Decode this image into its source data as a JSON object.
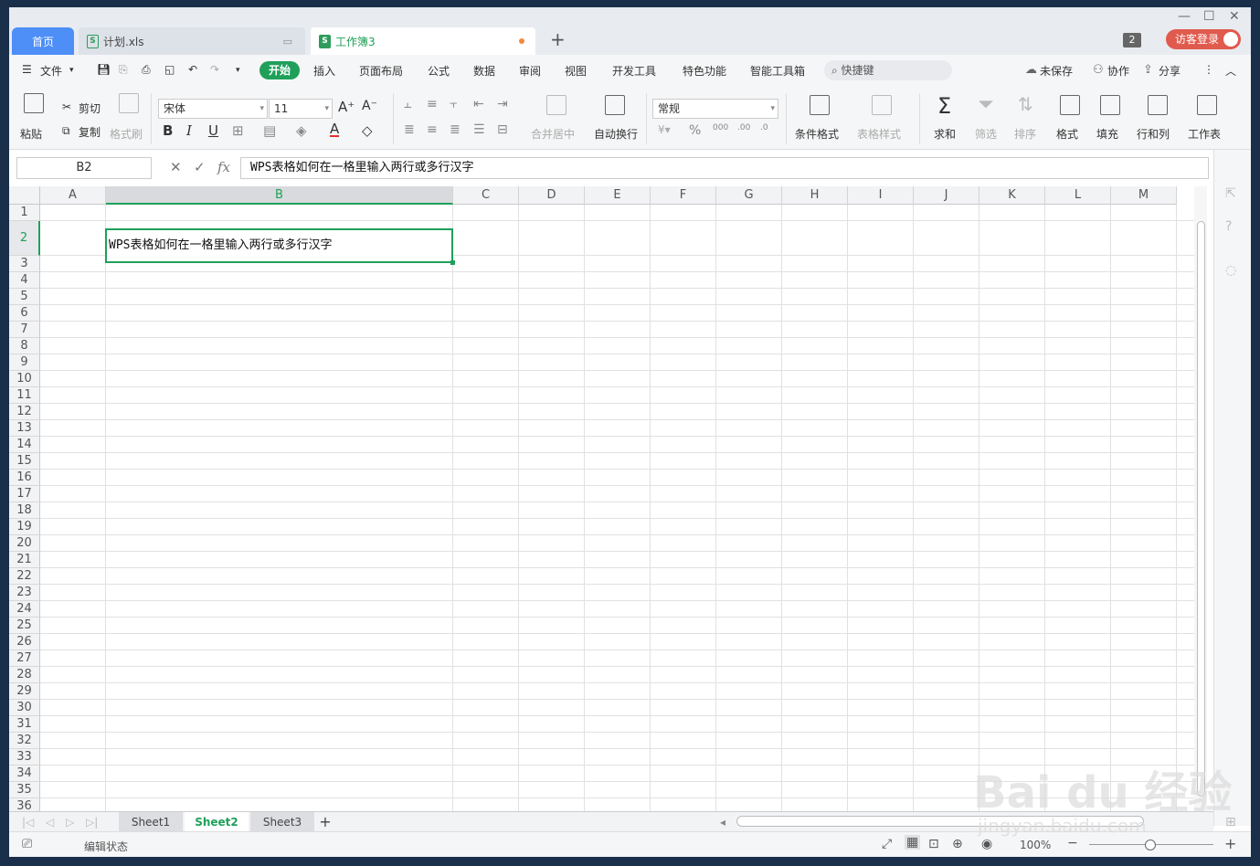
{
  "tabs": {
    "home": "首页",
    "file1": "计划.xls",
    "active": "工作簿3",
    "new": "+"
  },
  "titlebar": {
    "badge": "2",
    "login": "访客登录"
  },
  "menubar": {
    "file": "文件",
    "items": [
      "开始",
      "插入",
      "页面布局",
      "公式",
      "数据",
      "审阅",
      "视图",
      "开发工具",
      "特色功能",
      "智能工具箱"
    ],
    "search": "快捷键",
    "unsaved": "未保存",
    "collab": "协作",
    "share": "分享"
  },
  "ribbon": {
    "paste": "粘贴",
    "cut": "剪切",
    "copy": "复制",
    "format_painter": "格式刷",
    "font_name": "宋体",
    "font_size": "11",
    "merge_center": "合并居中",
    "wrap_text": "自动换行",
    "number_format": "常规",
    "conditional_format": "条件格式",
    "table_style": "表格样式",
    "sum": "求和",
    "filter": "筛选",
    "sort": "排序",
    "format": "格式",
    "fill": "填充",
    "rows_cols": "行和列",
    "worksheet": "工作表"
  },
  "formula": {
    "cell_ref": "B2",
    "value": "WPS表格如何在一格里输入两行或多行汉字"
  },
  "grid": {
    "columns": [
      "A",
      "B",
      "C",
      "D",
      "E",
      "F",
      "G",
      "H",
      "I",
      "J",
      "K",
      "L",
      "M"
    ],
    "rows": [
      "1",
      "2",
      "3",
      "4",
      "5",
      "6",
      "7",
      "8",
      "9",
      "10",
      "11",
      "12",
      "13",
      "14",
      "15",
      "16",
      "17",
      "18",
      "19",
      "20",
      "21",
      "22",
      "23",
      "24",
      "25",
      "26",
      "27",
      "28",
      "29",
      "30",
      "31",
      "32",
      "33",
      "34",
      "35",
      "36"
    ],
    "active_cell_text": "WPS表格如何在一格里输入两行或多行汉字"
  },
  "sheets": [
    "Sheet1",
    "Sheet2",
    "Sheet3"
  ],
  "status": {
    "mode": "编辑状态",
    "zoom": "100%"
  },
  "watermark": {
    "brand": "Bai du 经验",
    "url": "jingyan.baidu.com"
  }
}
